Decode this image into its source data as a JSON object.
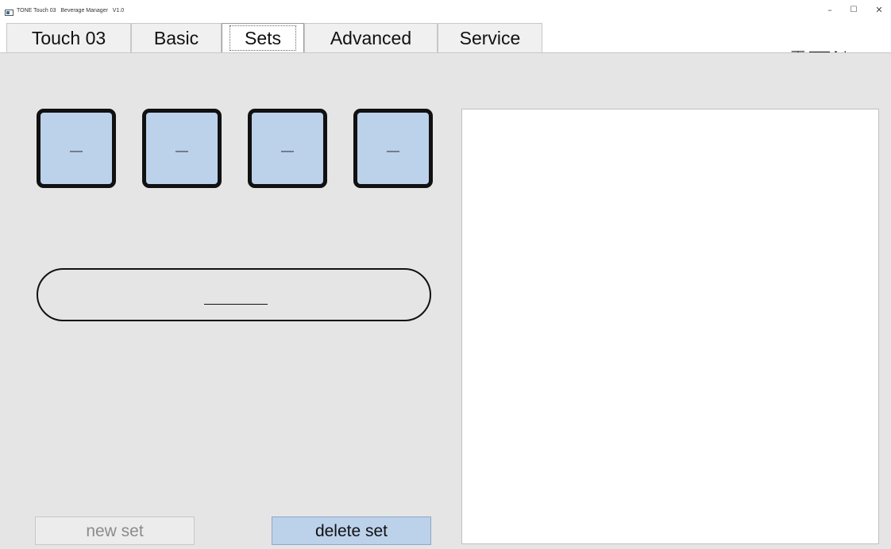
{
  "window": {
    "title": "TONE Touch 03   Beverage Manager   V1.0",
    "controls": {
      "minimize": "–",
      "maximize": "☐",
      "close": "✕"
    }
  },
  "tabs": [
    {
      "label": "Touch 03",
      "active": false
    },
    {
      "label": "Basic",
      "active": false
    },
    {
      "label": "Sets",
      "active": true
    },
    {
      "label": "Advanced",
      "active": false
    },
    {
      "label": "Service",
      "active": false
    }
  ],
  "logo": {
    "left": "T",
    "right": "N",
    "last": "≡"
  },
  "slots": [
    {
      "label": "—"
    },
    {
      "label": "—"
    },
    {
      "label": "—"
    },
    {
      "label": "—"
    }
  ],
  "buttons": {
    "new_set": "new set",
    "delete_set": "delete set"
  },
  "colors": {
    "slot_fill": "#bcd1ea",
    "content_bg": "#e5e5e5",
    "delete_button": "#bcd1ea"
  }
}
